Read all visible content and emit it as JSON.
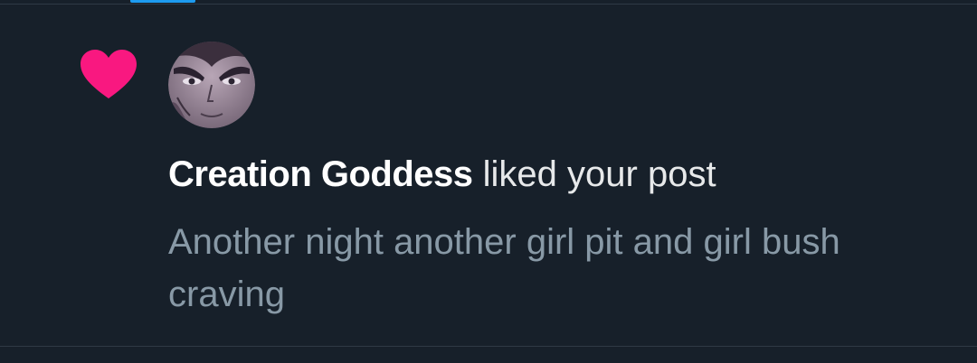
{
  "notification": {
    "type_icon": "heart-icon",
    "type_color": "#f91880",
    "avatar_icon": "avatar",
    "user_name": "Creation Goddess",
    "action_text": "liked your post",
    "post_text": "Another night another girl pit and girl bush craving"
  },
  "colors": {
    "background": "#17202a",
    "primary_text": "#e7e9ea",
    "secondary_text": "#8899a6",
    "divider": "#2f3a45",
    "accent": "#1d9bf0"
  }
}
